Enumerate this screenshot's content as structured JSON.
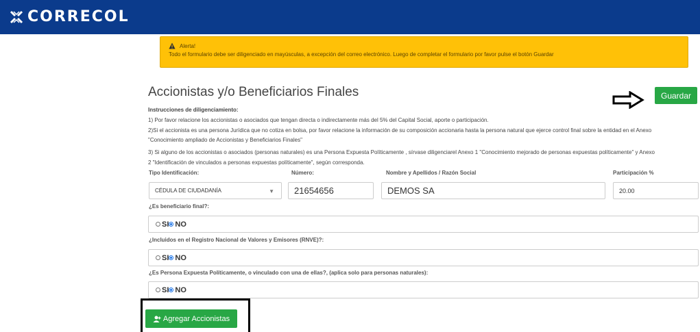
{
  "header": {
    "brand": "CORRECOL",
    "bg_color": "#0b3b8c"
  },
  "alert": {
    "title": "Alerta!",
    "message": "Todo el formulario debe ser diligenciado en mayúsculas, a excepción del correo electrónico. Luego de completar el formulario por favor pulse el botón Guardar",
    "color": "#ffc107"
  },
  "section": {
    "title": "Accionistas y/o Beneficiarios Finales",
    "save_label": "Guardar",
    "instructions_heading": "Instrucciones de diligenciamiento:",
    "instr1": "1) Por favor relacione los accionistas o asociados que tengan directa o indirectamente más del 5% del Capital Social, aporte o participación.",
    "instr2a": "2)Si el accionista es una persona Jurídica que no cotiza en bolsa, por favor relacione la información de su composición accionaria hasta la persona natural que ejerce control final sobre la entidad en el Anexo",
    "instr2b": "\"Conocimiento ampliado de Accionistas y Beneficiarios Finales\"",
    "instr3a": "3) Si alguno de los accionistas o asociados (personas naturales) es una Persona Expuesta Políticamente , sírvase diligenciarel Anexo 1 \"Conocimiento mejorado de personas expuestas políticamente\" y Anexo",
    "instr3b": "2 \"Identificación de vinculados a personas expuestas políticamente\", según corresponda."
  },
  "form": {
    "tipo_label": "Tipo Identificación:",
    "tipo_value": "CÉDULA DE CIUDADANÍA",
    "numero_label": "Número:",
    "numero_value": "21654656",
    "nombre_label": "Nombre y Apellidos / Razón Social",
    "nombre_value": "DEMOS SA",
    "participacion_label": "Participación %",
    "participacion_value": "20.00",
    "q1": "¿Es beneficiario final?:",
    "q2": "¿Incluidos en el Registro Nacional de Valores y Emisores (RNVE)?:",
    "q3": "¿Es Persona Expuesta Políticamente, o vinculado con una de ellas?, (aplica solo para personas naturales):",
    "opt_si": "SI",
    "opt_no": "NO",
    "add_label": "Agregar Accionistas",
    "green": "#28a745"
  }
}
